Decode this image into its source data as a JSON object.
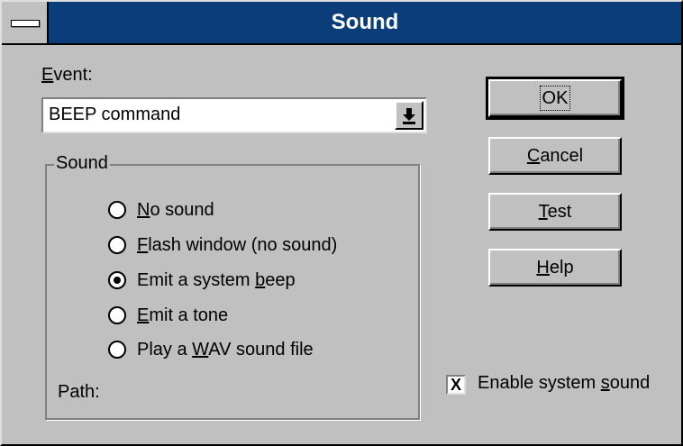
{
  "window": {
    "title": "Sound"
  },
  "event": {
    "label": "Event:",
    "selected_value": "BEEP command"
  },
  "sound_group": {
    "legend": "Sound",
    "options": [
      {
        "label": "No sound",
        "selected": false
      },
      {
        "label": "Flash window (no sound)",
        "selected": false
      },
      {
        "label": "Emit a system beep",
        "selected": true
      },
      {
        "label": "Emit a tone",
        "selected": false
      },
      {
        "label": "Play a WAV sound file",
        "selected": false
      }
    ],
    "path_label": "Path:"
  },
  "buttons": {
    "ok": "OK",
    "cancel": "Cancel",
    "test": "Test",
    "help": "Help"
  },
  "enable_system_sound": {
    "label": "Enable system sound",
    "checked": true,
    "mark": "X"
  },
  "icons": {
    "system_menu": "system-menu-icon",
    "dropdown": "dropdown-arrow-icon",
    "radio": "radio-icon"
  },
  "colors": {
    "titlebar": "#0a3d7a",
    "face": "#c0c0c0"
  }
}
